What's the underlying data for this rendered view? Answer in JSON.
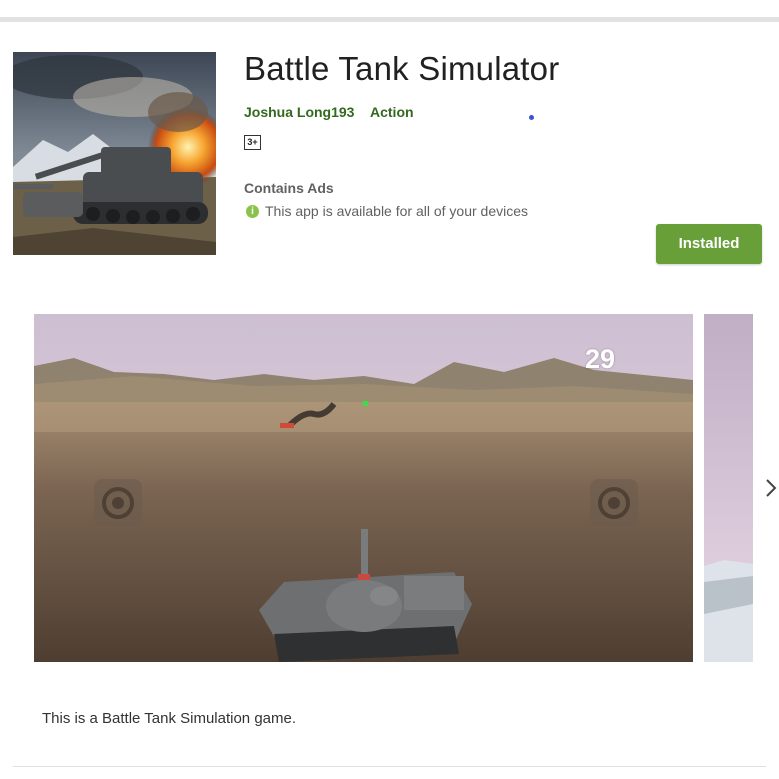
{
  "app": {
    "title": "Battle Tank Simulator",
    "developer": "Joshua Long193",
    "category": "Action",
    "content_rating": "3+",
    "contains_ads": "Contains Ads",
    "availability": "This app is available for all of your devices",
    "availability_icon": "info-icon",
    "install_label": "Installed",
    "description": "This is a Battle Tank Simulation game."
  },
  "screenshot": {
    "score": "29",
    "controls": [
      "fire-button-icon",
      "fire-button-icon"
    ]
  },
  "colors": {
    "accent_green": "#689f38",
    "meta_green": "#33691e",
    "info_green": "#8bc34a"
  }
}
